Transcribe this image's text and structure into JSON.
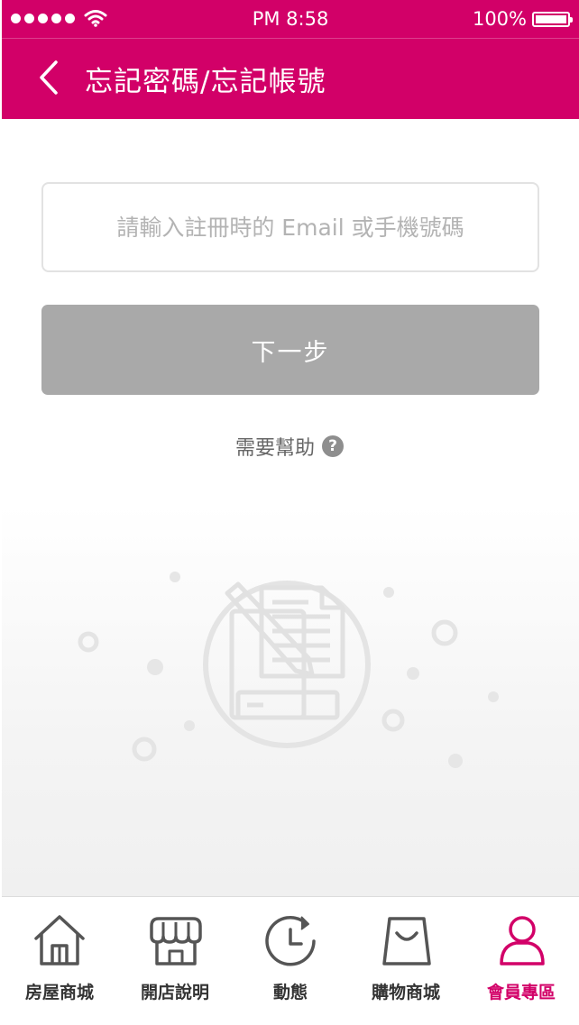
{
  "status_bar": {
    "time": "PM 8:58",
    "battery": "100%"
  },
  "nav": {
    "title": "忘記密碼/忘記帳號",
    "back_icon": "chevron-left-icon"
  },
  "form": {
    "input_placeholder": "請輸入註冊時的 Email 或手機號碼",
    "input_value": "",
    "next_label": "下一步",
    "help_label": "需要幫助",
    "help_icon_glyph": "?"
  },
  "tabs": [
    {
      "label": "房屋商城",
      "icon": "house-icon",
      "active": false
    },
    {
      "label": "開店說明",
      "icon": "storefront-icon",
      "active": false
    },
    {
      "label": "動態",
      "icon": "clock-refresh-icon",
      "active": false
    },
    {
      "label": "購物商城",
      "icon": "shopping-bag-icon",
      "active": false
    },
    {
      "label": "會員專區",
      "icon": "user-icon",
      "active": true
    }
  ],
  "colors": {
    "brand": "#d20068",
    "button_disabled": "#a9a9a9",
    "tab_icon": "#555555"
  }
}
